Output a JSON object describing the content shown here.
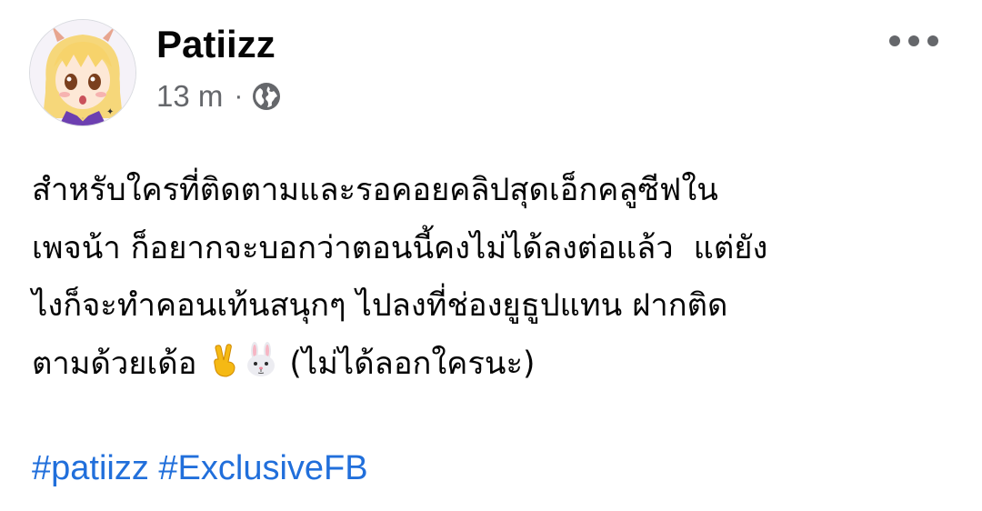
{
  "post": {
    "author": "Patiizz",
    "time": "13 m",
    "separator": "·",
    "privacy_icon": "globe-icon",
    "more_icon": "more-horizontal-icon",
    "text_lines": [
      "สำหรับใครที่ติดตามและรอคอยคลิปสุดเอ็กคลูซีฟใน",
      "เพจน้า ก็อยากจะบอกว่าตอนนี้คงไม่ได้ลงต่อแล้ว  แต่ยัง",
      "ไงก็จะทำคอนเท้นสนุกๆ ไปลงที่ช่องยูธูปแทน ฝากติด"
    ],
    "last_line_start": "ตามด้วยเด้อ ",
    "emoji_1": "victory-hand-emoji",
    "emoji_2": "rabbit-face-emoji",
    "last_line_end": " (ไม่ได้ลอกใครนะ)",
    "hashtags": [
      "#patiizz",
      "#ExclusiveFB"
    ]
  },
  "colors": {
    "text": "#050505",
    "secondary": "#65676b",
    "link": "#216fdb",
    "background": "#ffffff"
  }
}
